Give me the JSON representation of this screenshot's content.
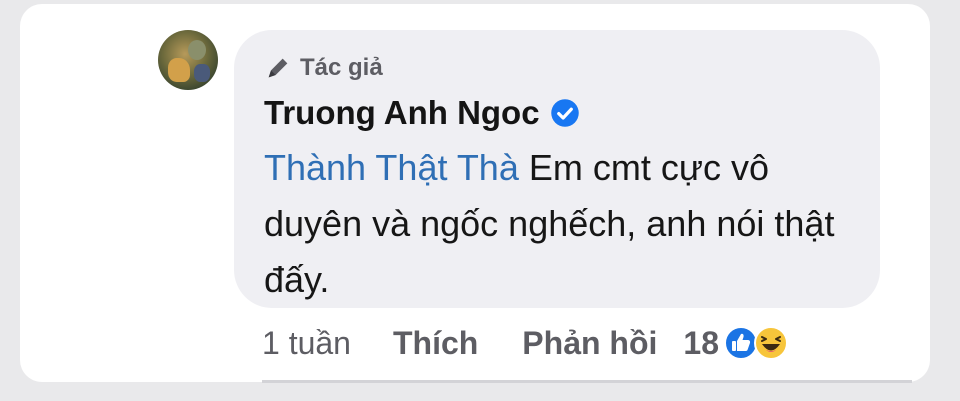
{
  "comment": {
    "author_badge": "Tác giả",
    "author_name": "Truong Anh Ngoc",
    "mention": "Thành Thật Thà",
    "text": " Em cmt cực vô duyên và ngốc nghếch, anh nói thật đấy."
  },
  "actions": {
    "time": "1 tuần",
    "like_label": "Thích",
    "reply_label": "Phản hồi",
    "reaction_count": "18"
  },
  "icons": {
    "badge": "pencil-icon",
    "verified": "verified-check-icon",
    "reactions": [
      "like-reaction-icon",
      "haha-reaction-icon"
    ]
  },
  "colors": {
    "mention": "#2f6fb5",
    "verified": "#1877f2",
    "bubble": "#efeff3"
  }
}
